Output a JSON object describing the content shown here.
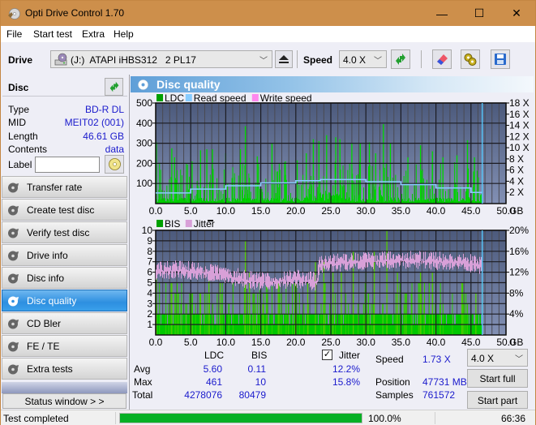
{
  "window": {
    "title": "Opti Drive Control 1.70",
    "controls": {
      "minimize": "—",
      "maximize": "☐",
      "close": "✕"
    }
  },
  "menu": [
    "File",
    "Start test",
    "Extra",
    "Help"
  ],
  "toolbar": {
    "drive_label": "Drive",
    "drive_value": "(J:)  ATAPI iHBS312   2 PL17",
    "speed_label": "Speed",
    "speed_value": "4.0 X",
    "icons": [
      "drive-icon",
      "eject-icon",
      "refresh-icon",
      "eraser-icon",
      "settings-icon",
      "save-icon"
    ]
  },
  "disc": {
    "header": "Disc",
    "fields": [
      {
        "key": "Type",
        "value": "BD-R DL"
      },
      {
        "key": "MID",
        "value": "MEIT02 (001)"
      },
      {
        "key": "Length",
        "value": "46.61 GB"
      },
      {
        "key": "Contents",
        "value": "data"
      }
    ],
    "label_key": "Label",
    "label_value": ""
  },
  "nav": {
    "items": [
      {
        "label": "Transfer rate",
        "active": false
      },
      {
        "label": "Create test disc",
        "active": false
      },
      {
        "label": "Verify test disc",
        "active": false
      },
      {
        "label": "Drive info",
        "active": false
      },
      {
        "label": "Disc info",
        "active": false
      },
      {
        "label": "Disc quality",
        "active": true
      },
      {
        "label": "CD Bler",
        "active": false
      },
      {
        "label": "FE / TE",
        "active": false
      },
      {
        "label": "Extra tests",
        "active": false
      }
    ],
    "status_window": "Status window > >"
  },
  "panel": {
    "title": "Disc quality"
  },
  "chart_data": [
    {
      "type": "bar",
      "title": "LDC / Read speed",
      "legend": [
        "LDC",
        "Read speed",
        "Write speed"
      ],
      "legend_colors": [
        "#00a000",
        "#88ccff",
        "#ff88ee"
      ],
      "legend_position": "top-left",
      "xlabel": "GB",
      "x_ticks": [
        "0.0",
        "5.0",
        "10.0",
        "15.0",
        "20.0",
        "25.0",
        "30.0",
        "35.0",
        "40.0",
        "45.0",
        "50.0"
      ],
      "xlim": [
        0,
        50
      ],
      "y_ticks_left": [
        "100",
        "200",
        "300",
        "400",
        "500"
      ],
      "ylim_left": [
        0,
        500
      ],
      "y_ticks_right": [
        "2 X",
        "4 X",
        "6 X",
        "8 X",
        "10 X",
        "12 X",
        "14 X",
        "16 X",
        "18 X"
      ],
      "ylim_right": [
        0,
        18
      ],
      "grid": true,
      "end_marker_gb": 46.61,
      "ldc_peaks": [
        {
          "x": 0.1,
          "y": 305
        },
        {
          "x": 2.3,
          "y": 275
        },
        {
          "x": 2.7,
          "y": 230
        },
        {
          "x": 5.2,
          "y": 210
        },
        {
          "x": 6.4,
          "y": 265
        },
        {
          "x": 7.3,
          "y": 270
        },
        {
          "x": 8.1,
          "y": 270
        },
        {
          "x": 10.0,
          "y": 250
        },
        {
          "x": 12.1,
          "y": 270
        },
        {
          "x": 12.8,
          "y": 385
        },
        {
          "x": 14.5,
          "y": 235
        },
        {
          "x": 16.6,
          "y": 300
        },
        {
          "x": 18.5,
          "y": 210
        },
        {
          "x": 20.2,
          "y": 215
        },
        {
          "x": 21.5,
          "y": 250
        },
        {
          "x": 22.5,
          "y": 320
        },
        {
          "x": 23.3,
          "y": 310
        },
        {
          "x": 24.4,
          "y": 340
        },
        {
          "x": 25.7,
          "y": 330
        },
        {
          "x": 26.3,
          "y": 320
        },
        {
          "x": 28.0,
          "y": 300
        },
        {
          "x": 29.2,
          "y": 300
        },
        {
          "x": 30.5,
          "y": 305
        },
        {
          "x": 32.5,
          "y": 395
        },
        {
          "x": 31.4,
          "y": 250
        },
        {
          "x": 33.5,
          "y": 300
        },
        {
          "x": 36.0,
          "y": 230
        },
        {
          "x": 37.8,
          "y": 290
        },
        {
          "x": 39.5,
          "y": 260
        },
        {
          "x": 41.0,
          "y": 230
        },
        {
          "x": 43.0,
          "y": 240
        },
        {
          "x": 44.5,
          "y": 315
        },
        {
          "x": 45.5,
          "y": 230
        }
      ],
      "read_speed": [
        {
          "x": 0,
          "y": 1.9
        },
        {
          "x": 5,
          "y": 2.6
        },
        {
          "x": 10,
          "y": 3.2
        },
        {
          "x": 15,
          "y": 3.7
        },
        {
          "x": 20,
          "y": 4.1
        },
        {
          "x": 23.5,
          "y": 4.3
        },
        {
          "x": 25,
          "y": 4.3
        },
        {
          "x": 30,
          "y": 3.9
        },
        {
          "x": 35,
          "y": 3.4
        },
        {
          "x": 40,
          "y": 2.8
        },
        {
          "x": 45,
          "y": 2.0
        },
        {
          "x": 46.61,
          "y": 1.9
        }
      ]
    },
    {
      "type": "bar",
      "title": "BIS / Jitter",
      "legend": [
        "BIS",
        "Jitter"
      ],
      "legend_colors": [
        "#00a000",
        "#d8a0d8"
      ],
      "legend_position": "top-left",
      "xlabel": "GB",
      "x_ticks": [
        "0.0",
        "5.0",
        "10.0",
        "15.0",
        "20.0",
        "25.0",
        "30.0",
        "35.0",
        "40.0",
        "45.0",
        "50.0"
      ],
      "xlim": [
        0,
        50
      ],
      "y_ticks_left": [
        "1",
        "2",
        "3",
        "4",
        "5",
        "6",
        "7",
        "8",
        "9",
        "10"
      ],
      "ylim_left": [
        0,
        10
      ],
      "y_ticks_right": [
        "4%",
        "8%",
        "12%",
        "16%",
        "20%"
      ],
      "ylim_right": [
        0,
        20
      ],
      "grid": true,
      "end_marker_gb": 46.61,
      "bis_peaks": [
        {
          "x": 0.1,
          "y": 5.5
        },
        {
          "x": 2.3,
          "y": 5
        },
        {
          "x": 6.4,
          "y": 4
        },
        {
          "x": 7.6,
          "y": 6
        },
        {
          "x": 9.2,
          "y": 5
        },
        {
          "x": 12.8,
          "y": 9
        },
        {
          "x": 13.4,
          "y": 6
        },
        {
          "x": 15.3,
          "y": 3
        },
        {
          "x": 17.5,
          "y": 5
        },
        {
          "x": 19.9,
          "y": 5
        },
        {
          "x": 21.7,
          "y": 5
        },
        {
          "x": 22.8,
          "y": 7
        },
        {
          "x": 24.0,
          "y": 7
        },
        {
          "x": 25.3,
          "y": 6
        },
        {
          "x": 26.5,
          "y": 6
        },
        {
          "x": 28.2,
          "y": 8
        },
        {
          "x": 30.0,
          "y": 6
        },
        {
          "x": 31.2,
          "y": 8
        },
        {
          "x": 33.0,
          "y": 10
        },
        {
          "x": 34.5,
          "y": 6
        },
        {
          "x": 37.8,
          "y": 6
        },
        {
          "x": 39.5,
          "y": 6
        },
        {
          "x": 43.7,
          "y": 5
        },
        {
          "x": 45.7,
          "y": 4
        }
      ],
      "bis_baseline": 2,
      "jitter_pct": [
        {
          "x": 0,
          "y": 12.0
        },
        {
          "x": 3,
          "y": 12.4
        },
        {
          "x": 7,
          "y": 11.8
        },
        {
          "x": 10,
          "y": 11.4
        },
        {
          "x": 13,
          "y": 10.4
        },
        {
          "x": 16,
          "y": 10.0
        },
        {
          "x": 20,
          "y": 10.6
        },
        {
          "x": 23,
          "y": 10.0
        },
        {
          "x": 23.4,
          "y": 13.2
        },
        {
          "x": 25,
          "y": 13.6
        },
        {
          "x": 30,
          "y": 14.0
        },
        {
          "x": 35,
          "y": 14.2
        },
        {
          "x": 40,
          "y": 14.0
        },
        {
          "x": 44,
          "y": 13.8
        },
        {
          "x": 46.61,
          "y": 13.0
        }
      ]
    }
  ],
  "stats": {
    "col_ldc": "LDC",
    "col_bis": "BIS",
    "jitter_label": "Jitter",
    "jitter_checked": true,
    "rows": [
      {
        "label": "Avg",
        "ldc": "5.60",
        "bis": "0.11",
        "jitter": "12.2%"
      },
      {
        "label": "Max",
        "ldc": "461",
        "bis": "10",
        "jitter": "15.8%"
      },
      {
        "label": "Total",
        "ldc": "4278076",
        "bis": "80479",
        "jitter": ""
      }
    ],
    "speed_label": "Speed",
    "speed_value": "1.73 X",
    "position_label": "Position",
    "position_value": "47731 MB",
    "samples_label": "Samples",
    "samples_value": "761572",
    "speed_select": "4.0 X",
    "start_full": "Start full",
    "start_part": "Start part"
  },
  "statusbar": {
    "text": "Test completed",
    "progress_pct": 100.0,
    "progress_text": "100.0%",
    "time": "66:36"
  }
}
